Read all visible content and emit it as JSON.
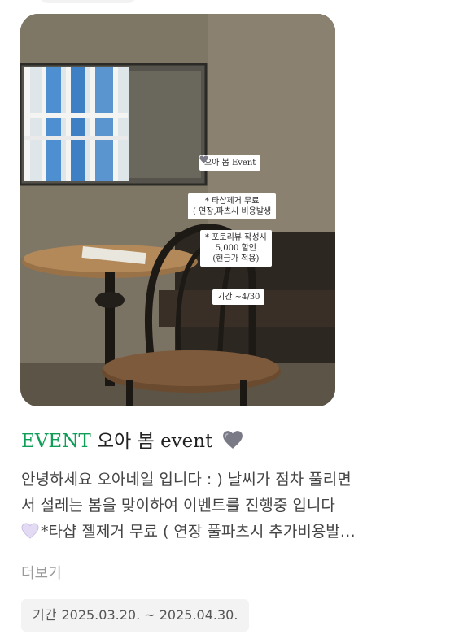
{
  "event_image": {
    "tags": {
      "headline": "오아 봄 Event",
      "offer1_line1": "* 타샵제거 무료",
      "offer1_line2": "( 연장,파츠시 비용발생",
      "offer2_line1": "* 포토리뷰 작성시",
      "offer2_line2": "5,000 할인",
      "offer2_line3": "(현금가 적용)",
      "period": "기간 ~4/30"
    },
    "heart_icon": "heart-icon"
  },
  "post": {
    "title_accent": "EVENT",
    "title_rest": "오아 봄 event",
    "description_line1": "안녕하세요 오아네일 입니다 : ) 날씨가 점차 풀리면",
    "description_line2": "서 설레는 봄을 맞이하여 이벤트를 진행중 입니다",
    "description_line3": "*타샵 젤제거 무료 ( 연장 풀파츠시 추가비용발…",
    "more_label": "더보기",
    "period_label": "기간",
    "period_value": "2025.03.20. ~ 2025.04.30."
  },
  "colors": {
    "accent": "#0f9d58",
    "title_heart": "#7a7a86",
    "desc_heart": "#d9cfee"
  }
}
